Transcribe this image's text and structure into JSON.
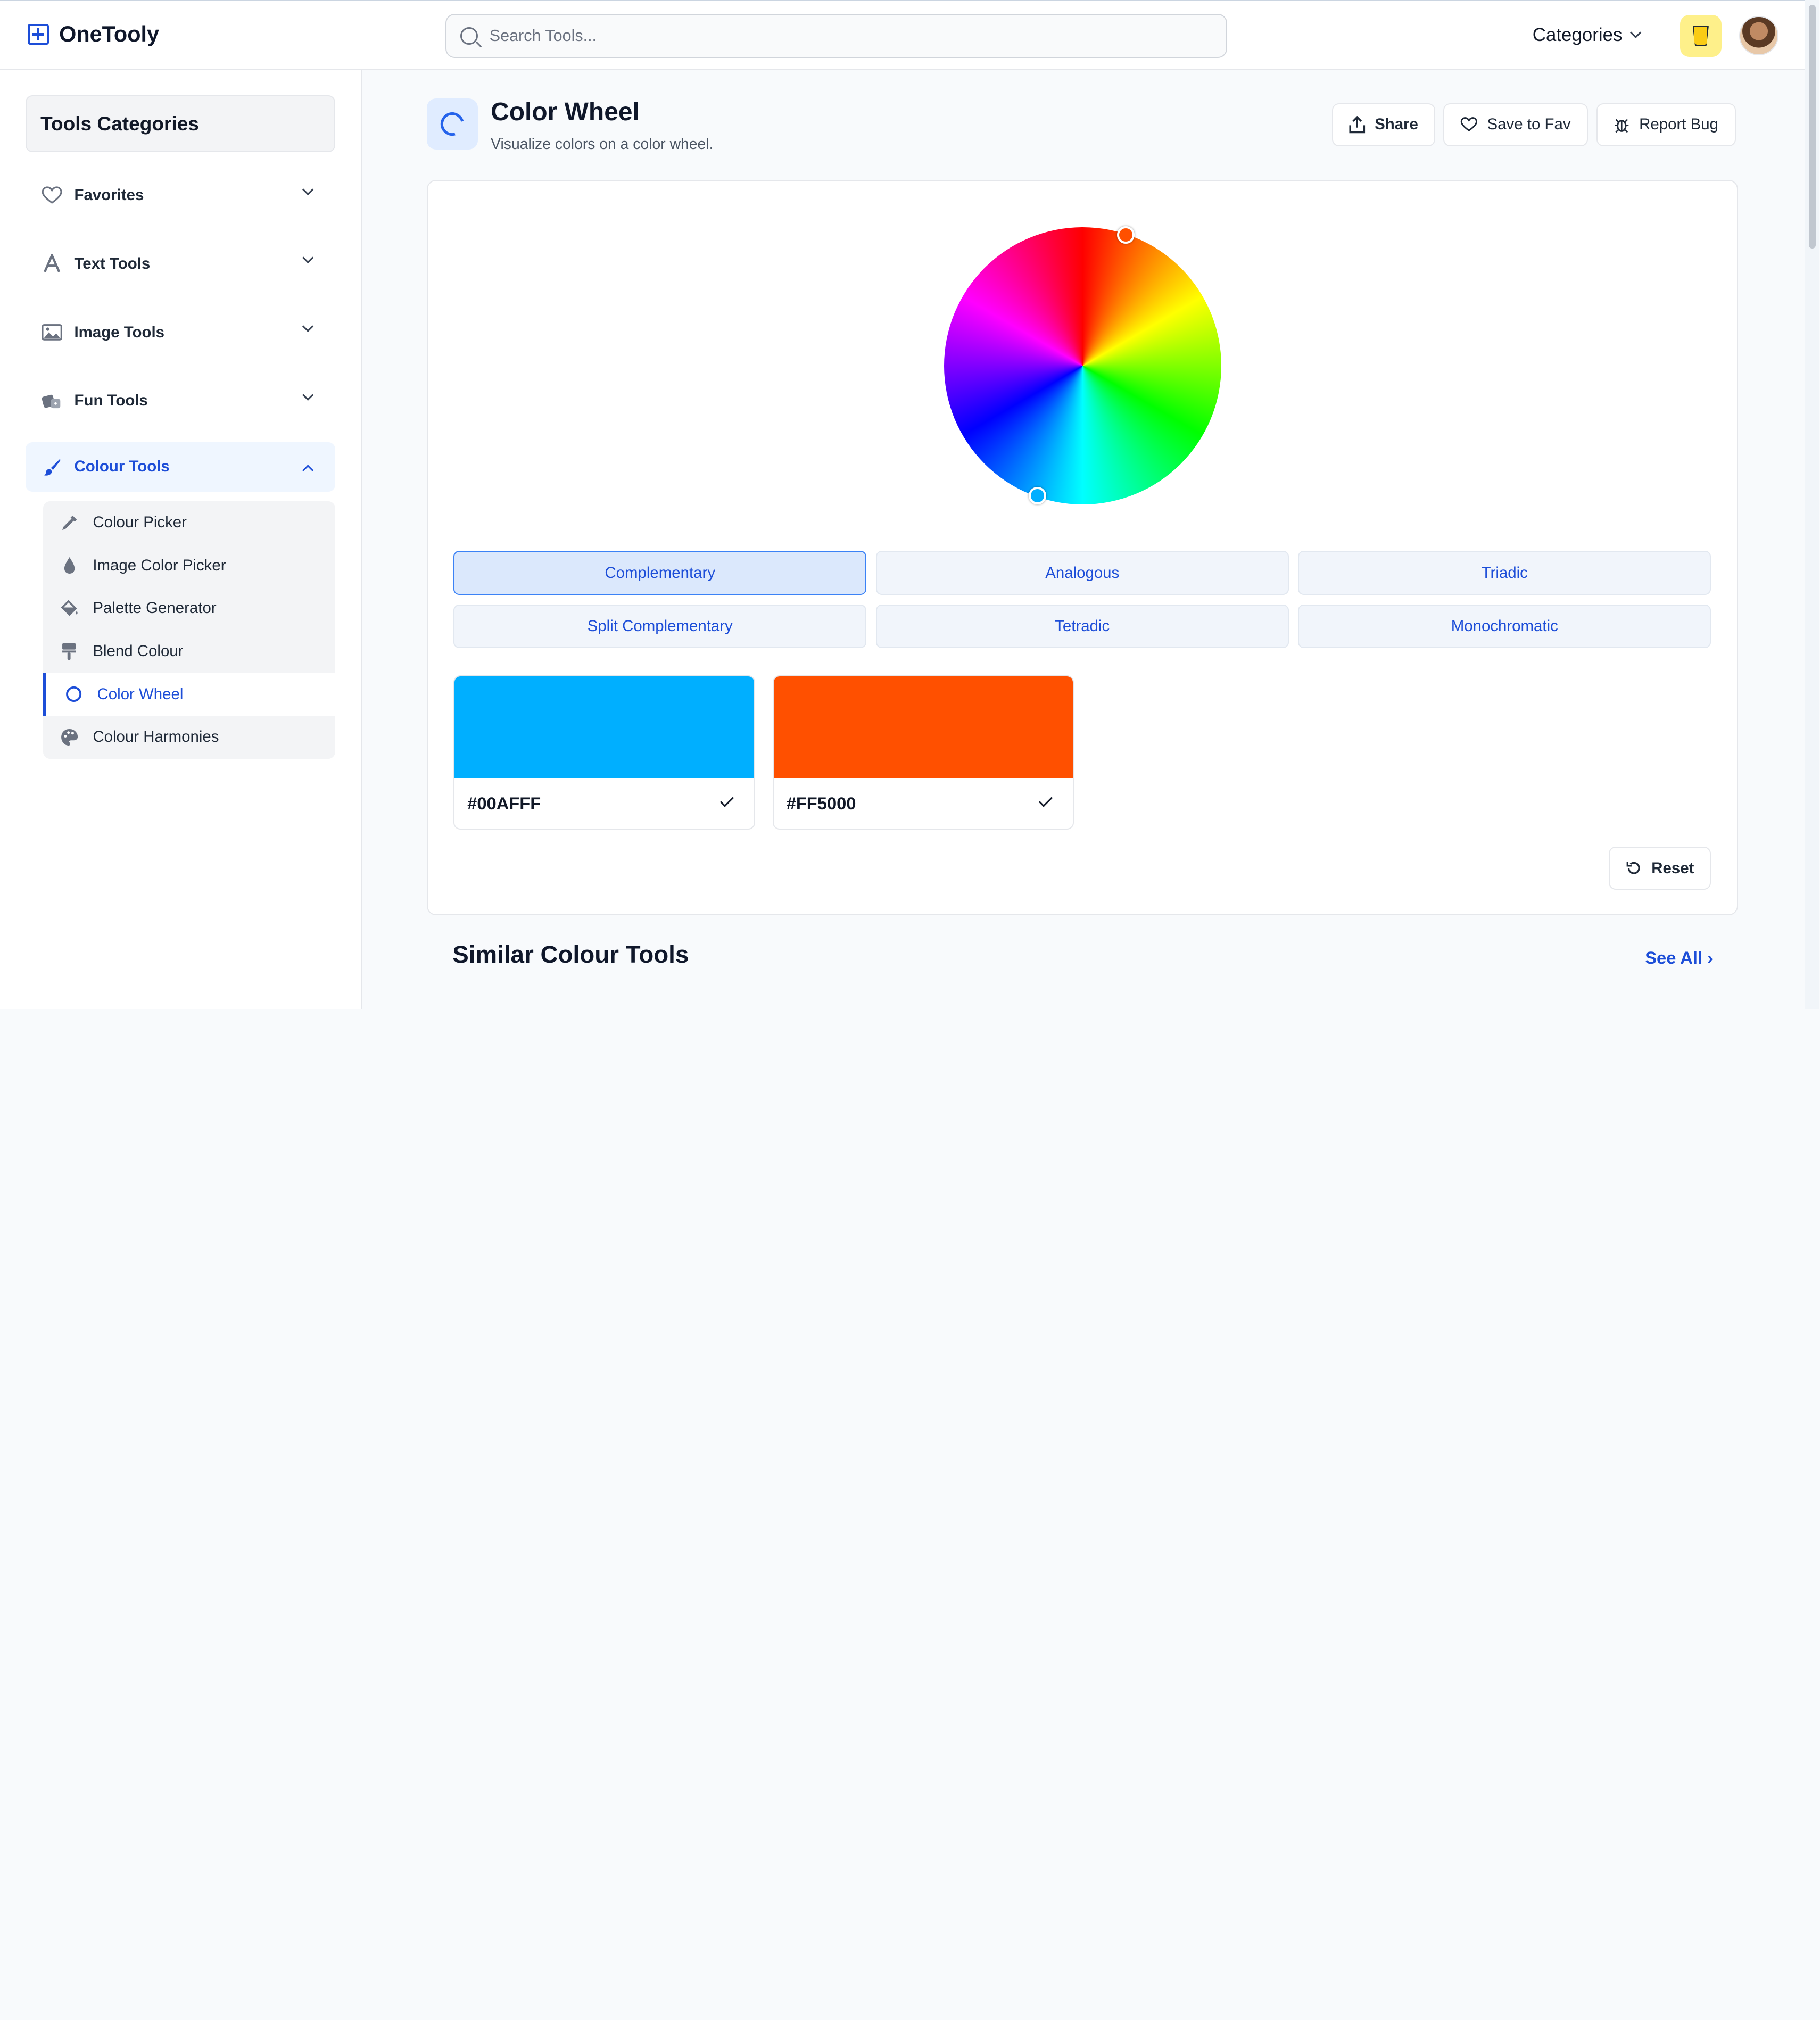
{
  "app": {
    "name": "OneTooly"
  },
  "search": {
    "placeholder": "Search Tools..."
  },
  "header": {
    "categories_label": "Categories"
  },
  "sidebar": {
    "title": "Tools Categories",
    "items": [
      {
        "label": "Favorites",
        "icon": "heart-icon"
      },
      {
        "label": "Text Tools",
        "icon": "text-icon"
      },
      {
        "label": "Image Tools",
        "icon": "image-icon"
      },
      {
        "label": "Fun Tools",
        "icon": "dice-icon"
      },
      {
        "label": "Colour Tools",
        "icon": "brush-icon",
        "expanded": true
      }
    ],
    "sub_items": [
      {
        "label": "Colour Picker",
        "icon": "eyedropper-icon"
      },
      {
        "label": "Image Color Picker",
        "icon": "droplet-icon"
      },
      {
        "label": "Palette Generator",
        "icon": "paint-bucket-icon"
      },
      {
        "label": "Blend Colour",
        "icon": "paint-roller-icon"
      },
      {
        "label": "Color Wheel",
        "icon": "circle-icon",
        "active": true
      },
      {
        "label": "Colour Harmonies",
        "icon": "palette-icon"
      }
    ]
  },
  "tool": {
    "title": "Color Wheel",
    "subtitle": "Visualize colors on a color wheel.",
    "actions": {
      "share": "Share",
      "save_fav": "Save to Fav",
      "report_bug": "Report Bug"
    }
  },
  "harmonies": [
    {
      "label": "Complementary",
      "active": true
    },
    {
      "label": "Analogous"
    },
    {
      "label": "Triadic"
    },
    {
      "label": "Split Complementary"
    },
    {
      "label": "Tetradic"
    },
    {
      "label": "Monochromatic"
    }
  ],
  "swatches": [
    {
      "hex": "#00AFFF",
      "color": "#00AFFF"
    },
    {
      "hex": "#FF5000",
      "color": "#FF5000"
    }
  ],
  "reset_label": "Reset",
  "similar": {
    "title": "Similar Colour Tools",
    "see_all": "See All ›"
  },
  "colors": {
    "accent": "#1D4ED8",
    "handle_primary": "#FF5000",
    "handle_secondary": "#00AFFF"
  }
}
